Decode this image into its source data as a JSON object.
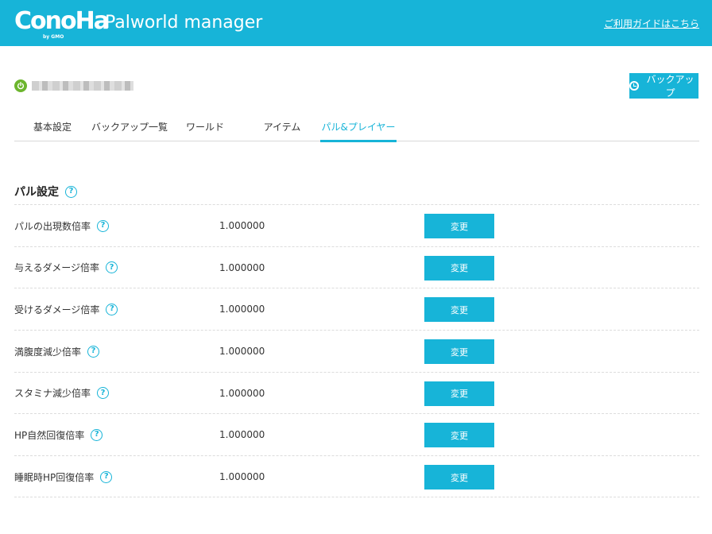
{
  "header": {
    "logo_text": "ConoHa",
    "logo_sub": "by GMO",
    "app_title": "Palworld manager",
    "guide_link": "ご利用ガイドはこちら"
  },
  "server": {
    "status_icon": "power-icon",
    "status_color": "#6cb52d"
  },
  "backup_button": "バックアップ",
  "tabs": [
    {
      "label": "基本設定"
    },
    {
      "label": "バックアップ一覧"
    },
    {
      "label": "ワールド"
    },
    {
      "label": "アイテム"
    },
    {
      "label": "パル&プレイヤー",
      "active": true
    }
  ],
  "section": {
    "title": "パル設定"
  },
  "settings": [
    {
      "label": "パルの出現数倍率",
      "value": "1.000000",
      "button": "変更"
    },
    {
      "label": "与えるダメージ倍率",
      "value": "1.000000",
      "button": "変更"
    },
    {
      "label": "受けるダメージ倍率",
      "value": "1.000000",
      "button": "変更"
    },
    {
      "label": "満腹度減少倍率",
      "value": "1.000000",
      "button": "変更"
    },
    {
      "label": "スタミナ減少倍率",
      "value": "1.000000",
      "button": "変更"
    },
    {
      "label": "HP自然回復倍率",
      "value": "1.000000",
      "button": "変更"
    },
    {
      "label": "睡眠時HP回復倍率",
      "value": "1.000000",
      "button": "変更"
    }
  ],
  "colors": {
    "accent": "#17b4d8",
    "status_on": "#6cb52d"
  }
}
